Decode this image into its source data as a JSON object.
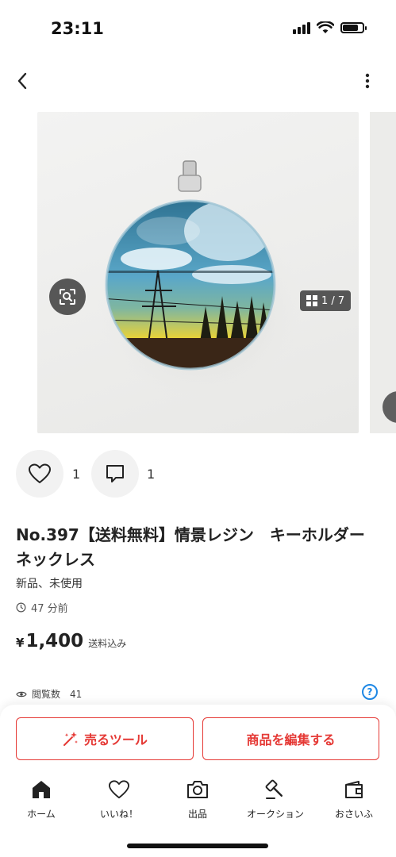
{
  "status_bar": {
    "time": "23:11",
    "battery_level": 0.8
  },
  "carousel": {
    "page_indicator": "1 / 7",
    "current": 1,
    "total": 7
  },
  "actions": {
    "like_count": "1",
    "comment_count": "1"
  },
  "product": {
    "title": "No.397【送料無料】情景レジン　キーホルダー　ネックレス",
    "condition": "新品、未使用",
    "posted_ago": "47 分前",
    "price_currency": "¥",
    "price": "1,400",
    "price_note": "送料込み",
    "views_label": "閲覧数",
    "views_count": "41"
  },
  "buttons": {
    "sell_tool": "売るツール",
    "edit": "商品を編集する"
  },
  "tabs": [
    {
      "label": "ホーム",
      "icon": "home-icon"
    },
    {
      "label": "いいね！",
      "icon": "heart-icon"
    },
    {
      "label": "出品",
      "icon": "camera-icon"
    },
    {
      "label": "オークション",
      "icon": "gavel-icon"
    },
    {
      "label": "おさいふ",
      "icon": "wallet-icon"
    }
  ],
  "colors": {
    "accent": "#e53935",
    "help": "#1e88e5"
  }
}
